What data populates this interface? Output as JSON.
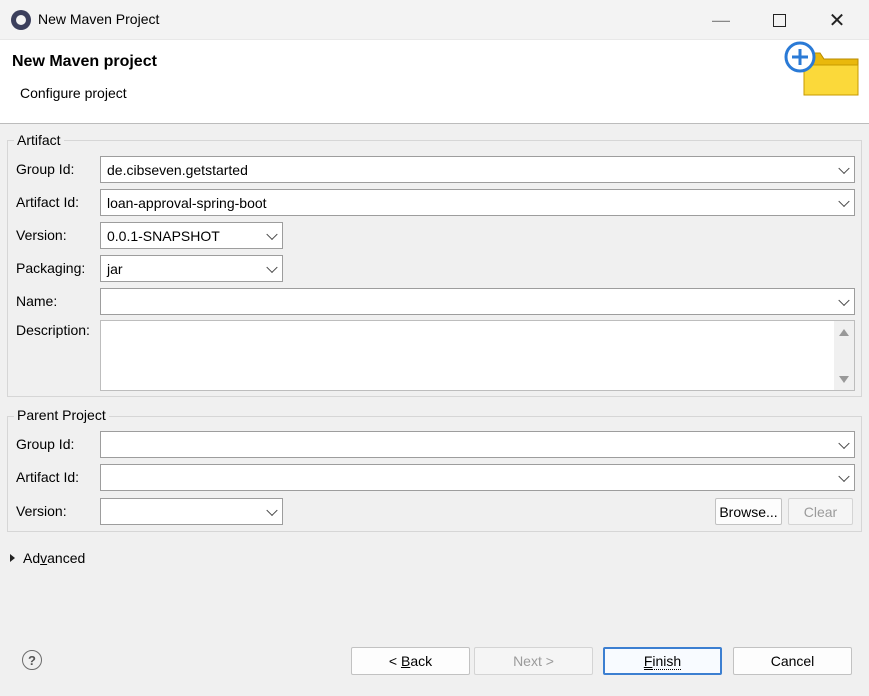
{
  "window": {
    "title": "New Maven Project",
    "minimize_icon": "minimize-icon",
    "maximize_icon": "maximize-icon",
    "close_icon": "close-icon"
  },
  "header": {
    "title": "New Maven project",
    "subtitle": "Configure project",
    "icon": "new-folder-icon"
  },
  "artifact": {
    "section_label": "Artifact",
    "group_id_label": "Group Id:",
    "group_id_value": "de.cibseven.getstarted",
    "artifact_id_label": "Artifact Id:",
    "artifact_id_value": "loan-approval-spring-boot",
    "version_label": "Version:",
    "version_value": "0.0.1-SNAPSHOT",
    "packaging_label": "Packaging:",
    "packaging_value": "jar",
    "name_label": "Name:",
    "name_value": "",
    "description_label": "Description:",
    "description_value": ""
  },
  "parent": {
    "section_label": "Parent Project",
    "group_id_label": "Group Id:",
    "group_id_value": "",
    "artifact_id_label": "Artifact Id:",
    "artifact_id_value": "",
    "version_label": "Version:",
    "version_value": "",
    "browse_label": "Browse...",
    "clear_label": "Clear"
  },
  "advanced": {
    "label_prefix": "Ad",
    "label_mnemonic": "v",
    "label_suffix": "anced"
  },
  "footer": {
    "back_prefix": "< ",
    "back_mnemonic": "B",
    "back_suffix": "ack",
    "next_label": "Next >",
    "finish_mnemonic": "F",
    "finish_suffix": "inish",
    "cancel_label": "Cancel"
  }
}
